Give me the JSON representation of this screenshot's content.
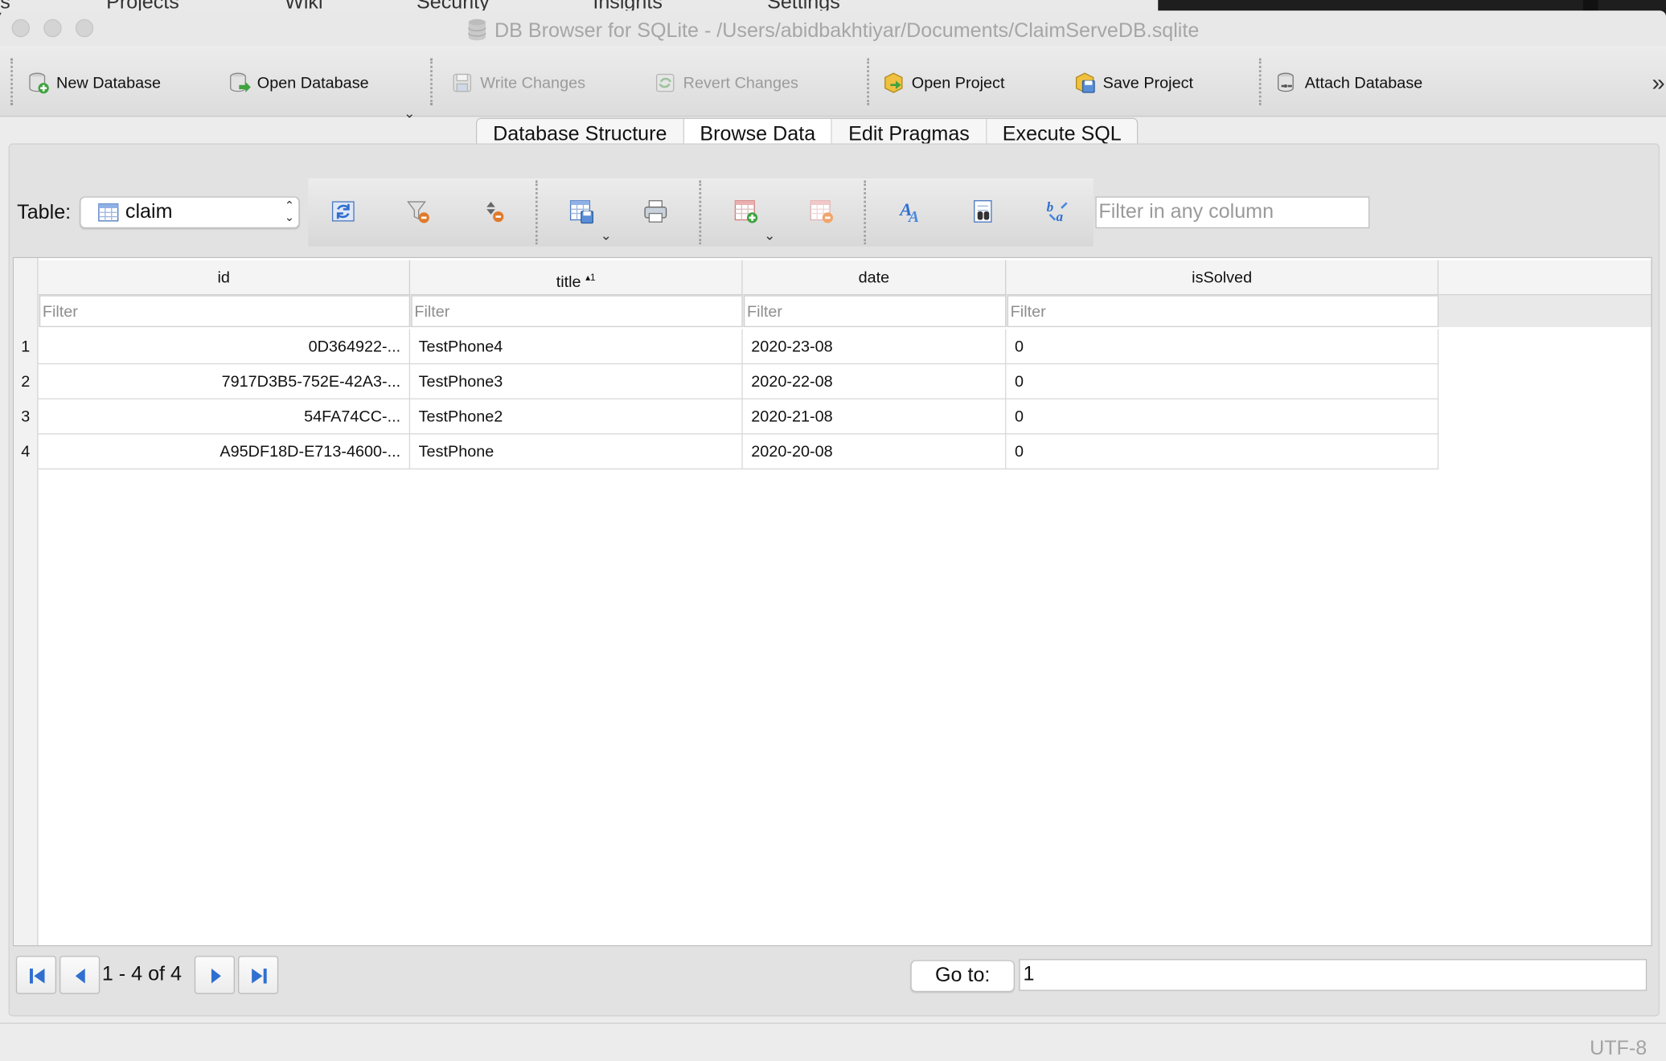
{
  "background_menu": {
    "items": [
      "ls",
      "Projects",
      "Wiki",
      "Security",
      "Insights",
      "Settings"
    ]
  },
  "window": {
    "title": "DB Browser for SQLite - /Users/abidbakhtiyar/Documents/ClaimServeDB.sqlite"
  },
  "toolbar": {
    "new_database": "New Database",
    "open_database": "Open Database",
    "write_changes": "Write Changes",
    "revert_changes": "Revert Changes",
    "open_project": "Open Project",
    "save_project": "Save Project",
    "attach_database": "Attach Database",
    "more": "»"
  },
  "tabs": [
    {
      "label": "Database Structure"
    },
    {
      "label": "Browse Data"
    },
    {
      "label": "Edit Pragmas"
    },
    {
      "label": "Execute SQL"
    }
  ],
  "browse": {
    "table_label": "Table:",
    "table_value": "claim",
    "filter_any_placeholder": "Filter in any column",
    "filter_placeholder": "Filter",
    "sort_indicator": "▴1",
    "columns": [
      "id",
      "title",
      "date",
      "isSolved"
    ],
    "rows": [
      {
        "num": "1",
        "id": "0D364922-...",
        "title": "TestPhone4",
        "date": "2020-23-08",
        "isSolved": "0"
      },
      {
        "num": "2",
        "id": "7917D3B5-752E-42A3-...",
        "title": "TestPhone3",
        "date": "2020-22-08",
        "isSolved": "0"
      },
      {
        "num": "3",
        "id": "54FA74CC-...",
        "title": "TestPhone2",
        "date": "2020-21-08",
        "isSolved": "0"
      },
      {
        "num": "4",
        "id": "A95DF18D-E713-4600-...",
        "title": "TestPhone",
        "date": "2020-20-08",
        "isSolved": "0"
      }
    ]
  },
  "pager": {
    "range_text": "1 - 4 of 4",
    "goto_label": "Go to:",
    "goto_value": "1"
  },
  "status": {
    "encoding": "UTF-8"
  },
  "colors": {
    "accent_blue": "#2f6fd0",
    "window_bg": "#ececec"
  }
}
